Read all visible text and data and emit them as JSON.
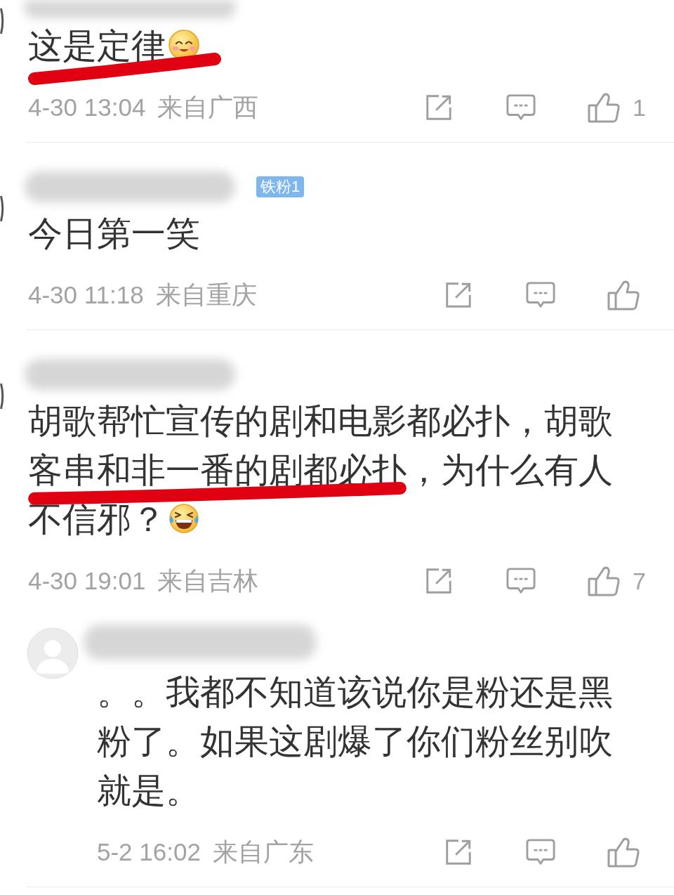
{
  "comments": [
    {
      "content": [
        {
          "kind": "text",
          "text": "这是定律",
          "marked": true
        },
        {
          "kind": "smile"
        }
      ],
      "time": "4-30 13:04",
      "location": "来自广西",
      "likes": "1"
    },
    {
      "badge": "铁粉1",
      "content": [
        {
          "kind": "text",
          "text": "今日第一笑",
          "marked": false
        }
      ],
      "time": "4-30 11:18",
      "location": "来自重庆"
    },
    {
      "content": [
        {
          "kind": "text",
          "text": "胡歌帮忙宣传的剧和电影都必扑，胡歌",
          "marked": false
        },
        {
          "kind": "text",
          "text": "客串和非一番的剧都必扑",
          "marked": true
        },
        {
          "kind": "text",
          "text": "，为什么有人不信邪？",
          "marked": false
        },
        {
          "kind": "laugh"
        }
      ],
      "time": "4-30 19:01",
      "location": "来自吉林",
      "likes": "7",
      "replies": [
        {
          "content": [
            {
              "kind": "text",
              "text": "。。我都不知道该说你是粉还是黑粉了。如果这剧爆了你们粉丝别吹就是。",
              "marked": false
            }
          ],
          "time": "5-2 16:02",
          "location": "来自广东"
        }
      ]
    }
  ]
}
